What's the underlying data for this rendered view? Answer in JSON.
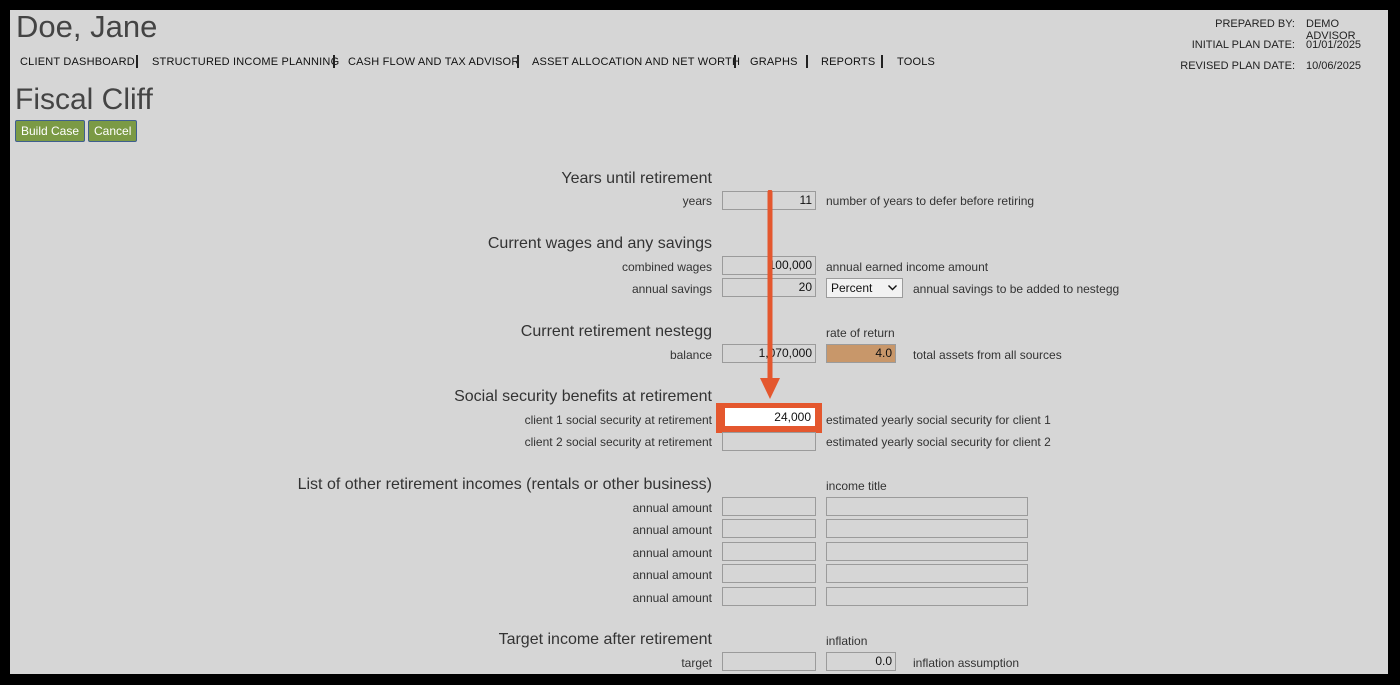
{
  "client_name": "Doe, Jane",
  "header_meta": {
    "prepared_by_label": "PREPARED BY:",
    "prepared_by": "DEMO ADVISOR",
    "initial_label": "INITIAL PLAN DATE:",
    "initial_date": "01/01/2025",
    "revised_label": "REVISED PLAN DATE:",
    "revised_date": "10/06/2025"
  },
  "nav": [
    "CLIENT DASHBOARD",
    "STRUCTURED INCOME PLANNING",
    "CASH FLOW AND TAX ADVISOR",
    "ASSET ALLOCATION AND NET WORTH",
    "GRAPHS",
    "REPORTS",
    "TOOLS"
  ],
  "page_title": "Fiscal Cliff",
  "buttons": {
    "build": "Build Case",
    "cancel": "Cancel"
  },
  "years": {
    "heading": "Years until retirement",
    "label": "years",
    "value": "11",
    "desc": "number of years to defer before retiring"
  },
  "wages": {
    "heading": "Current wages and any savings",
    "combined_label": "combined wages",
    "combined_value": "100,000",
    "combined_desc": "annual earned income amount",
    "savings_label": "annual savings",
    "savings_value": "20",
    "savings_type": "Percent",
    "savings_desc": "annual savings to be added to nestegg"
  },
  "nestegg": {
    "heading": "Current retirement nestegg",
    "rate_heading": "rate of return",
    "balance_label": "balance",
    "balance_value": "1,070,000",
    "rate_value": "4.0",
    "desc": "total assets from all sources"
  },
  "social_security": {
    "heading": "Social security benefits at retirement",
    "c1_label": "client 1 social security at retirement",
    "c1_value": "24,000",
    "c1_desc": "estimated yearly social security for client 1",
    "c2_label": "client 2 social security at retirement",
    "c2_value": "",
    "c2_desc": "estimated yearly social security for client 2"
  },
  "other_incomes": {
    "heading": "List of other retirement incomes (rentals or other business)",
    "title_heading": "income title",
    "rows": [
      {
        "label": "annual amount",
        "amount": "",
        "title": ""
      },
      {
        "label": "annual amount",
        "amount": "",
        "title": ""
      },
      {
        "label": "annual amount",
        "amount": "",
        "title": ""
      },
      {
        "label": "annual amount",
        "amount": "",
        "title": ""
      },
      {
        "label": "annual amount",
        "amount": "",
        "title": ""
      }
    ]
  },
  "target": {
    "heading": "Target income after retirement",
    "inflation_heading": "inflation",
    "label": "target",
    "value": "",
    "inflation_value": "0.0",
    "desc": "inflation assumption"
  },
  "colors": {
    "highlight": "#e4572e",
    "rate_field": "#c8976a",
    "button": "#7b9a45"
  }
}
